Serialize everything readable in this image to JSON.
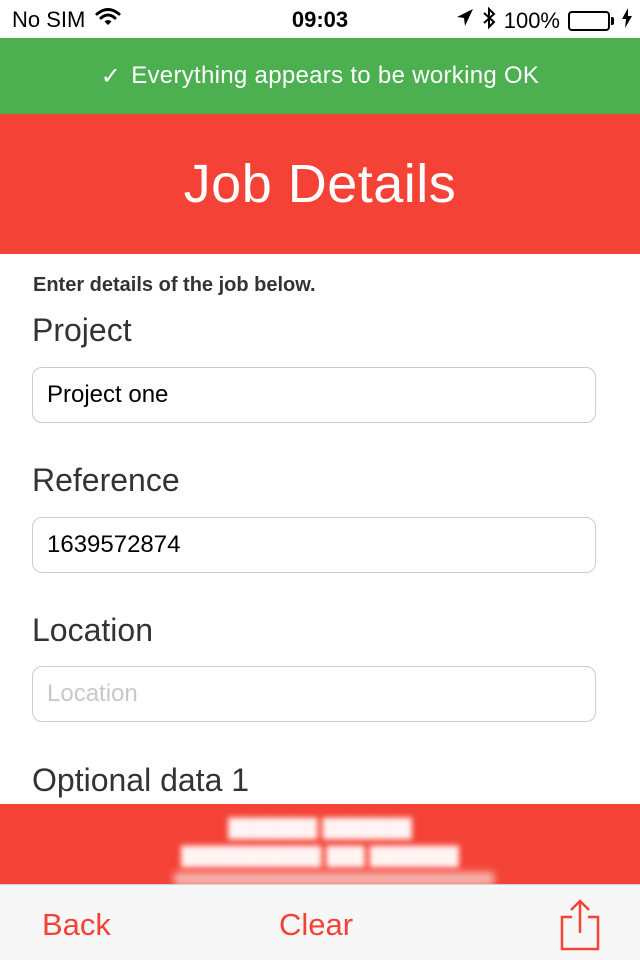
{
  "status_bar": {
    "carrier": "No SIM",
    "time": "09:03",
    "battery_percent": "100%",
    "battery_level": 1.0
  },
  "banner": {
    "check": "✓",
    "text": "Everything appears to be working OK",
    "color": "#4caf50"
  },
  "header": {
    "title": "Job Details",
    "color": "#f44336"
  },
  "form": {
    "intro": "Enter details of the job below.",
    "fields": [
      {
        "label": "Project",
        "value": "Project one",
        "placeholder": ""
      },
      {
        "label": "Reference",
        "value": "1639572874",
        "placeholder": ""
      },
      {
        "label": "Location",
        "value": "",
        "placeholder": "Location"
      },
      {
        "label": "Optional data 1"
      }
    ]
  },
  "toolbar": {
    "back_label": "Back",
    "clear_label": "Clear",
    "share_icon": "share-icon"
  }
}
